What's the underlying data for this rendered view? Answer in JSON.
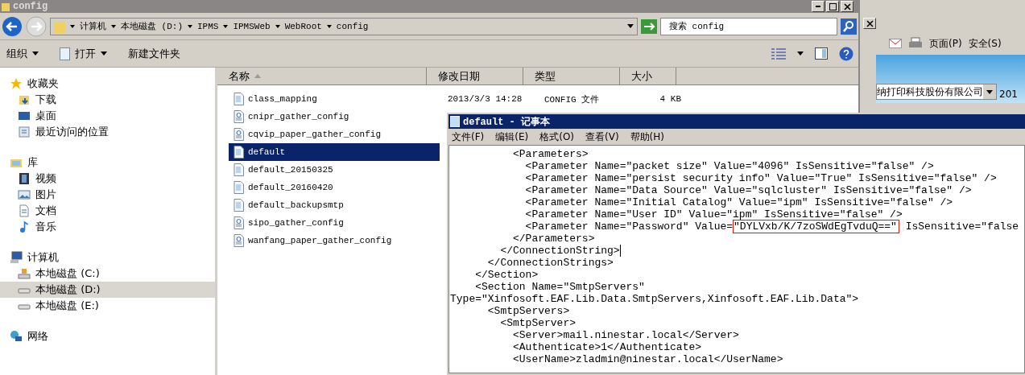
{
  "explorer": {
    "title": "config",
    "breadcrumb": [
      "计算机",
      "本地磁盘 (D:)",
      "IPMS",
      "IPMSWeb",
      "WebRoot",
      "config"
    ],
    "search": {
      "placeholder": "搜索 config"
    },
    "toolbar": [
      {
        "label": "组织",
        "menu": true,
        "kind": "plain"
      },
      {
        "label": "打开",
        "menu": true,
        "kind": "open"
      },
      {
        "label": "新建文件夹",
        "menu": false,
        "kind": "plain"
      }
    ],
    "nav": [
      {
        "label": "收藏夹",
        "kind": "star",
        "selected": false,
        "children": [
          {
            "label": "下载",
            "kind": "download",
            "selected": false
          },
          {
            "label": "桌面",
            "kind": "desktop",
            "selected": false
          },
          {
            "label": "最近访问的位置",
            "kind": "recent",
            "selected": false
          }
        ]
      },
      {
        "label": "库",
        "kind": "library",
        "selected": false,
        "children": [
          {
            "label": "视频",
            "kind": "video",
            "selected": false
          },
          {
            "label": "图片",
            "kind": "picture",
            "selected": false
          },
          {
            "label": "文档",
            "kind": "document",
            "selected": false
          },
          {
            "label": "音乐",
            "kind": "music",
            "selected": false
          }
        ]
      },
      {
        "label": "计算机",
        "kind": "computer",
        "selected": false,
        "children": [
          {
            "label": "本地磁盘 (C:)",
            "kind": "system-drive",
            "selected": false
          },
          {
            "label": "本地磁盘 (D:)",
            "kind": "drive",
            "selected": true
          },
          {
            "label": "本地磁盘 (E:)",
            "kind": "drive",
            "selected": false
          }
        ]
      },
      {
        "label": "网络",
        "kind": "network",
        "selected": false
      }
    ],
    "columns": [
      "名称",
      "修改日期",
      "类型",
      "大小"
    ],
    "files": [
      {
        "name": "class_mapping",
        "kind": "text",
        "selected": false,
        "date": "2013/3/3 14:28",
        "type": "CONFIG 文件",
        "size": "4 KB"
      },
      {
        "name": "cnipr_gather_config",
        "kind": "settings",
        "selected": false
      },
      {
        "name": "cqvip_paper_gather_config",
        "kind": "settings",
        "selected": false
      },
      {
        "name": "default",
        "kind": "text",
        "selected": true
      },
      {
        "name": "default_20150325",
        "kind": "text",
        "selected": false
      },
      {
        "name": "default_20160420",
        "kind": "text",
        "selected": false
      },
      {
        "name": "default_backupsmtp",
        "kind": "text",
        "selected": false
      },
      {
        "name": "sipo_gather_config",
        "kind": "settings",
        "selected": false
      },
      {
        "name": "wanfang_paper_gather_config",
        "kind": "settings",
        "selected": false
      }
    ]
  },
  "browser": {
    "toolbar": [
      "页面(P)",
      "安全(S)"
    ],
    "company": "纳打印科技股份有限公司",
    "year": "201"
  },
  "notepad": {
    "title": "default - 记事本",
    "menu": [
      "文件(F)",
      "编辑(E)",
      "格式(O)",
      "查看(V)",
      "帮助(H)"
    ],
    "lines": [
      {
        "text": "          <Parameters>",
        "caret": false
      },
      {
        "text": "            <Parameter Name=\"packet size\" Value=\"4096\" IsSensitive=\"false\" />",
        "caret": false
      },
      {
        "text": "            <Parameter Name=\"persist security info\" Value=\"True\" IsSensitive=\"false\" />",
        "caret": false
      },
      {
        "text": "            <Parameter Name=\"Data Source\" Value=\"sqlcluster\" IsSensitive=\"false\" />",
        "caret": false
      },
      {
        "text": "            <Parameter Name=\"Initial Catalog\" Value=\"ipm\" IsSensitive=\"false\" />",
        "caret": false
      },
      {
        "text": "            <Parameter Name=\"User ID\" Value=\"ipm\" IsSensitive=\"false\" />",
        "caret": false
      },
      {
        "text": "            <Parameter Name=\"Password\" Value=",
        "marked": "\"DYLVxb/K/7zoSWdEgTvduQ==\"",
        "rest": " IsSensitive=\"false",
        "caret": false
      },
      {
        "text": "          </Parameters>",
        "caret": false
      },
      {
        "text": "        </ConnectionString>",
        "caret": true
      },
      {
        "text": "      </ConnectionStrings>",
        "caret": false
      },
      {
        "text": "    </Section>",
        "caret": false
      },
      {
        "text": "    <Section Name=\"SmtpServers\"",
        "caret": false
      },
      {
        "text": "Type=\"Xinfosoft.EAF.Lib.Data.SmtpServers,Xinfosoft.EAF.Lib.Data\">",
        "caret": false
      },
      {
        "text": "      <SmtpServers>",
        "caret": false
      },
      {
        "text": "        <SmtpServer>",
        "caret": false
      },
      {
        "text": "          <Server>mail.ninestar.local</Server>",
        "caret": false
      },
      {
        "text": "          <Authenticate>1</Authenticate>",
        "caret": false
      },
      {
        "text": "          <UserName>zladmin@ninestar.local</UserName>",
        "caret": false
      }
    ]
  }
}
